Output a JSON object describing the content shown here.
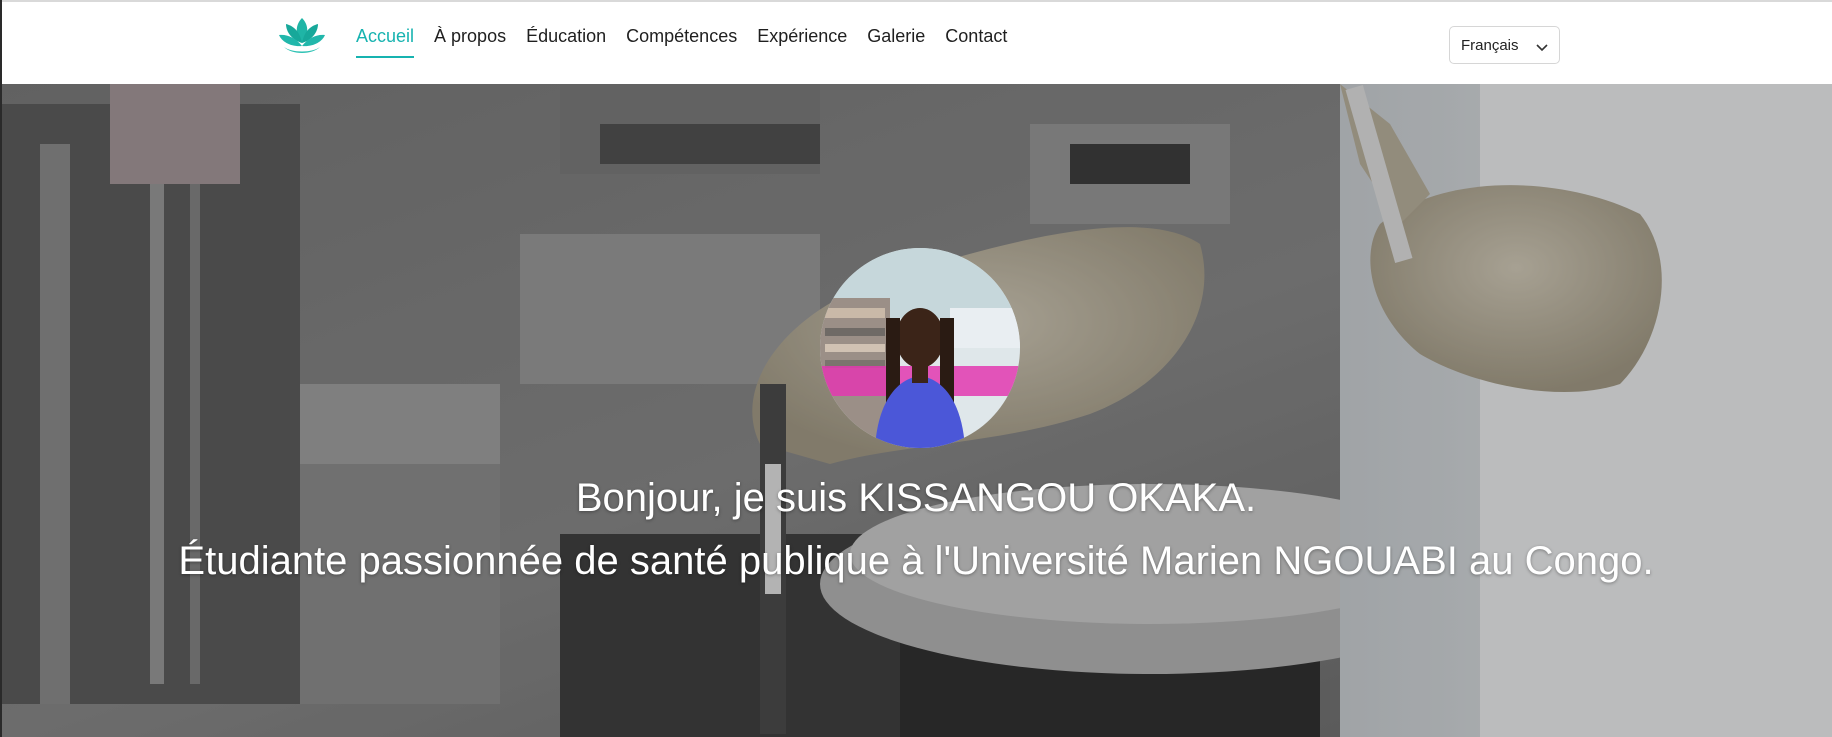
{
  "header": {
    "logo_icon": "lotus-icon",
    "nav": [
      {
        "label": "Accueil",
        "active": true
      },
      {
        "label": "À propos",
        "active": false
      },
      {
        "label": "Éducation",
        "active": false
      },
      {
        "label": "Compétences",
        "active": false
      },
      {
        "label": "Expérience",
        "active": false
      },
      {
        "label": "Galerie",
        "active": false
      },
      {
        "label": "Contact",
        "active": false
      }
    ],
    "language": {
      "selected": "Français",
      "icon": "chevron-down-icon"
    }
  },
  "hero": {
    "greeting": "Bonjour, je suis KISSANGOU OKAKA.",
    "tagline": "Étudiante passionnée de santé publique à l'Université Marien NGOUABI au Congo."
  },
  "colors": {
    "accent": "#17b3b0",
    "nav_text": "#1f1f1f"
  }
}
